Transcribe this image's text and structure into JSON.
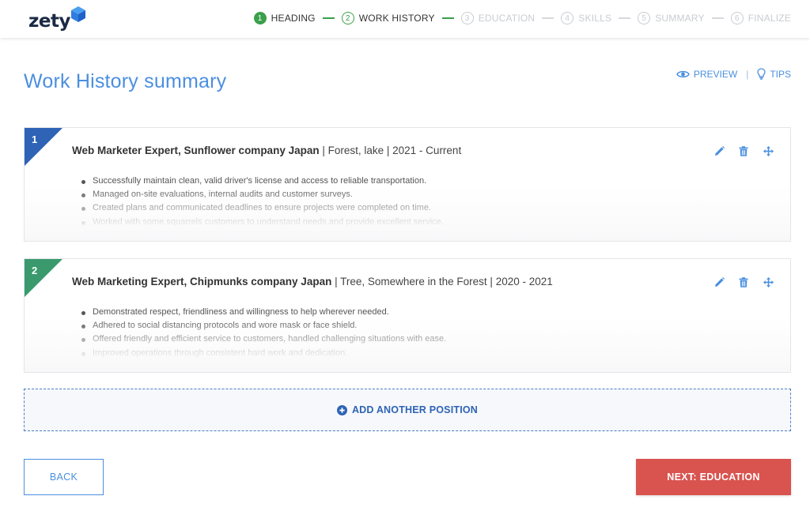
{
  "brand": {
    "name": "zety"
  },
  "colors": {
    "accent": "#4a8fe0",
    "step_done": "#3aa04a",
    "step_todo": "#c9ccd2",
    "card1_corner": "#2e63b5",
    "card2_corner": "#3a9a6e",
    "next_button": "#d9534f"
  },
  "steps": [
    {
      "num": "1",
      "label": "HEADING",
      "state": "done"
    },
    {
      "num": "2",
      "label": "WORK HISTORY",
      "state": "current"
    },
    {
      "num": "3",
      "label": "EDUCATION",
      "state": "todo"
    },
    {
      "num": "4",
      "label": "SKILLS",
      "state": "todo"
    },
    {
      "num": "5",
      "label": "SUMMARY",
      "state": "todo"
    },
    {
      "num": "6",
      "label": "FINALIZE",
      "state": "todo"
    }
  ],
  "page": {
    "title": "Work History summary",
    "preview_label": "PREVIEW",
    "tips_label": "TIPS",
    "separator": "|"
  },
  "positions": [
    {
      "number": "1",
      "title": "Web Marketer Expert, Sunflower company Japan",
      "details": "| Forest, lake | 2021 - Current",
      "bullets": [
        "Successfully maintain clean, valid driver's license and access to reliable transportation.",
        "Managed on-site evaluations, internal audits and customer surveys.",
        "Created plans and communicated deadlines to ensure projects were completed on time.",
        "Worked with some squarrels customers to understand needs and provide excellent service."
      ]
    },
    {
      "number": "2",
      "title": "Web Marketing Expert, Chipmunks company Japan",
      "details": "| Tree, Somewhere in the Forest | 2020 - 2021",
      "bullets": [
        "Demonstrated respect, friendliness and willingness to help wherever needed.",
        "Adhered to social distancing protocols and wore mask or face shield.",
        "Offered friendly and efficient service to customers, handled challenging situations with ease.",
        "Improved operations through consistent hard work and dedication."
      ]
    }
  ],
  "actions": {
    "add_position_label": "ADD ANOTHER POSITION",
    "back_label": "BACK",
    "next_label": "NEXT: EDUCATION"
  },
  "icons": {
    "edit": "pencil-icon",
    "delete": "trash-icon",
    "move": "move-arrows-icon",
    "preview": "eye-icon",
    "tips": "lightbulb-icon",
    "add": "plus-circle-icon"
  }
}
